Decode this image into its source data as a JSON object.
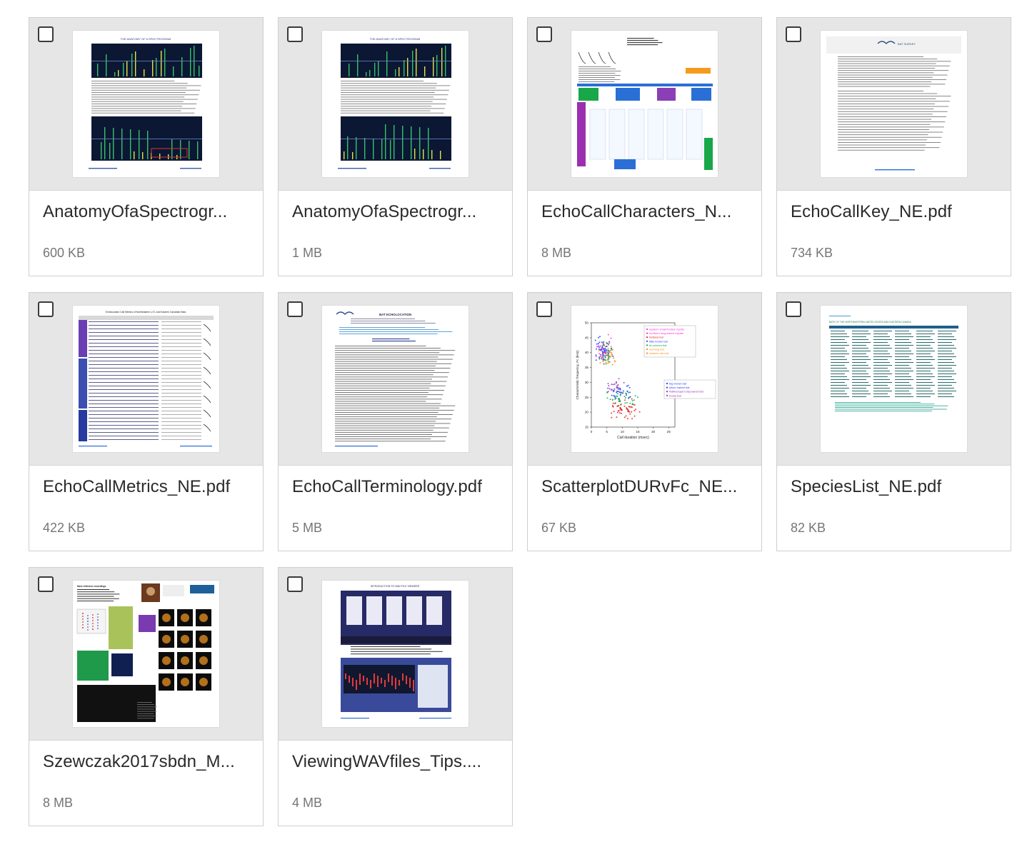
{
  "files": [
    {
      "name": "AnatomyOfaSpectrogr...",
      "size": "600 KB",
      "thumb": "spectro-a",
      "thumb_title": "The Anatomy of a Spectrogram"
    },
    {
      "name": "AnatomyOfaSpectrogr...",
      "size": "1 MB",
      "thumb": "spectro-b",
      "thumb_title": "The Anatomy of a Spectrogram"
    },
    {
      "name": "EchoCallCharacters_N...",
      "size": "8 MB",
      "thumb": "characters",
      "thumb_title": "Qualitative Manual Identification of Northeastern U.S. and Canadian Bat Echolocation Calls"
    },
    {
      "name": "EchoCallKey_NE.pdf",
      "size": "734 KB",
      "thumb": "key",
      "thumb_title": "Bat Survey"
    },
    {
      "name": "EchoCallMetrics_NE.pdf",
      "size": "422 KB",
      "thumb": "metrics",
      "thumb_title": "Echolocation Call Metrics of Northeastern U.S. and Eastern Canadian Bats"
    },
    {
      "name": "EchoCallTerminology.pdf",
      "size": "5 MB",
      "thumb": "terminology",
      "thumb_title": "Bat Echolocation"
    },
    {
      "name": "ScatterplotDURvFc_NE...",
      "size": "67 KB",
      "thumb": "scatter",
      "thumb_title": ""
    },
    {
      "name": "SpeciesList_NE.pdf",
      "size": "82 KB",
      "thumb": "species",
      "thumb_title": "Bats of the Northeastern United States and Eastern Canada"
    },
    {
      "name": "Szewczak2017sbdn_M...",
      "size": "8 MB",
      "thumb": "poster",
      "thumb_title": "More reference recordings decrease, rather than increase, acoustic classification performance of Myotis sodalis and M. lucifugus"
    },
    {
      "name": "ViewingWAVfiles_Tips....",
      "size": "4 MB",
      "thumb": "viewer",
      "thumb_title": "Introduction to WAV File Viewers"
    }
  ],
  "scatter": {
    "ylabel": "Characteristic frequency, Fc (kHz)",
    "xlabel": "Call duration (msec)",
    "x_ticks": [
      "0",
      "5",
      "10",
      "15",
      "20",
      "25"
    ],
    "y_ticks": [
      "15",
      "20",
      "25",
      "30",
      "35",
      "40",
      "45",
      "50"
    ],
    "legend_top": [
      "eastern small-footed myotis",
      "northern long-eared myotis",
      "Indiana bat",
      "little brown bat",
      "tri-colored bat",
      "evening bat",
      "eastern red bat"
    ],
    "legend_bottom": [
      "big brown bat",
      "silver-haired bat",
      "Rafinesque's big-eared bat",
      "hoary bat"
    ]
  },
  "colors": {
    "card_border": "#cfcfcf",
    "thumb_bg": "#e6e6e6",
    "name_text": "#2a2a2a",
    "size_text": "#767676"
  }
}
